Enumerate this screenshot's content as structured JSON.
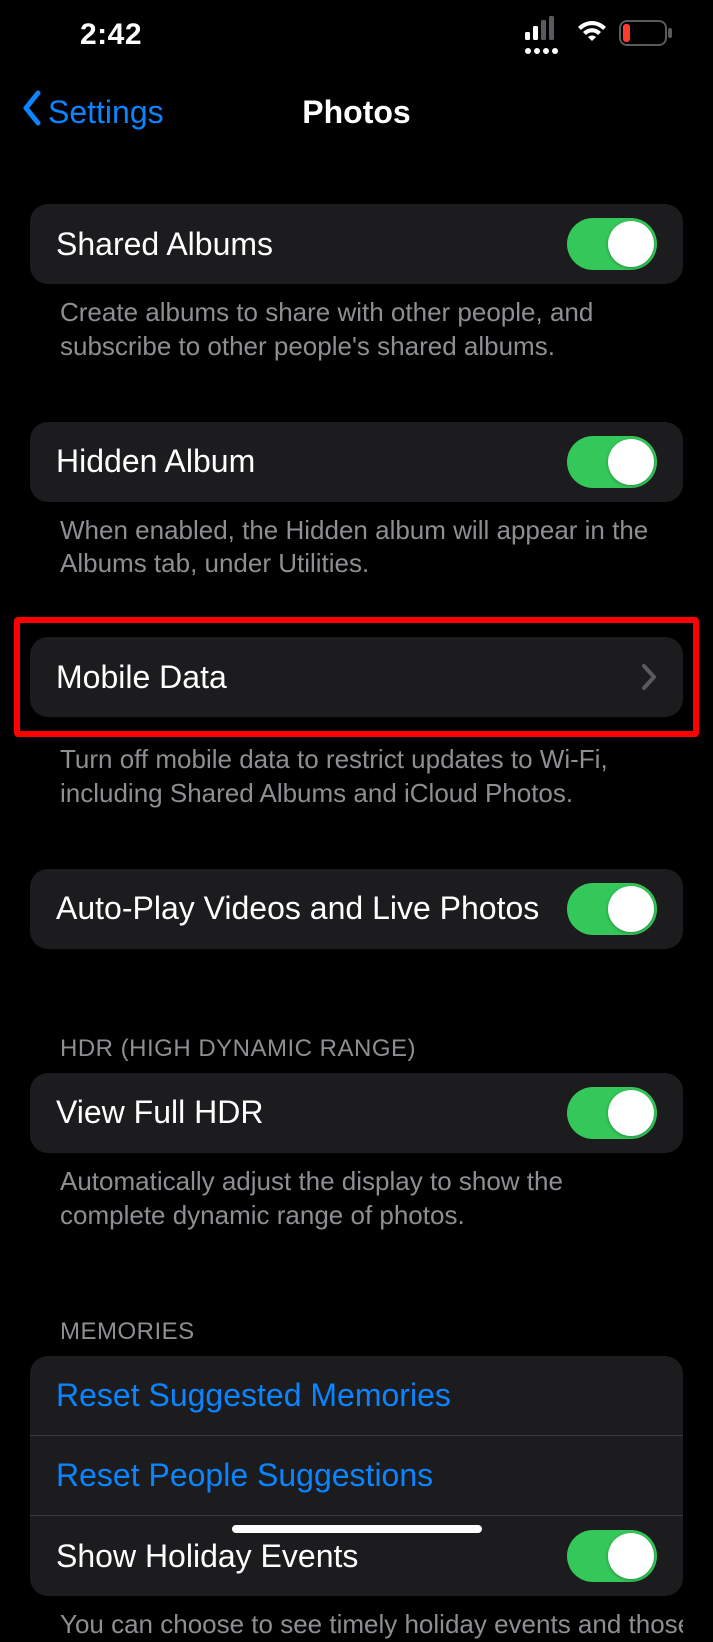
{
  "statusbar": {
    "time": "2:42"
  },
  "nav": {
    "back": "Settings",
    "title": "Photos"
  },
  "settings": {
    "sharedAlbums": {
      "label": "Shared Albums",
      "footer": "Create albums to share with other people, and subscribe to other people's shared albums."
    },
    "hiddenAlbum": {
      "label": "Hidden Album",
      "footer": "When enabled, the Hidden album will appear in the Albums tab, under Utilities."
    },
    "mobileData": {
      "label": "Mobile Data",
      "footer": "Turn off mobile data to restrict updates to Wi-Fi, including Shared Albums and iCloud Photos."
    },
    "autoPlay": {
      "label": "Auto-Play Videos and Live Photos"
    },
    "hdr": {
      "header": "HDR (HIGH DYNAMIC RANGE)",
      "viewFull": "View Full HDR",
      "footer": "Automatically adjust the display to show the complete dynamic range of photos."
    },
    "memories": {
      "header": "MEMORIES",
      "resetSuggested": "Reset Suggested Memories",
      "resetPeople": "Reset People Suggestions",
      "showHoliday": "Show Holiday Events",
      "footer": "You can choose to see timely holiday events and those for your home country or region"
    }
  }
}
